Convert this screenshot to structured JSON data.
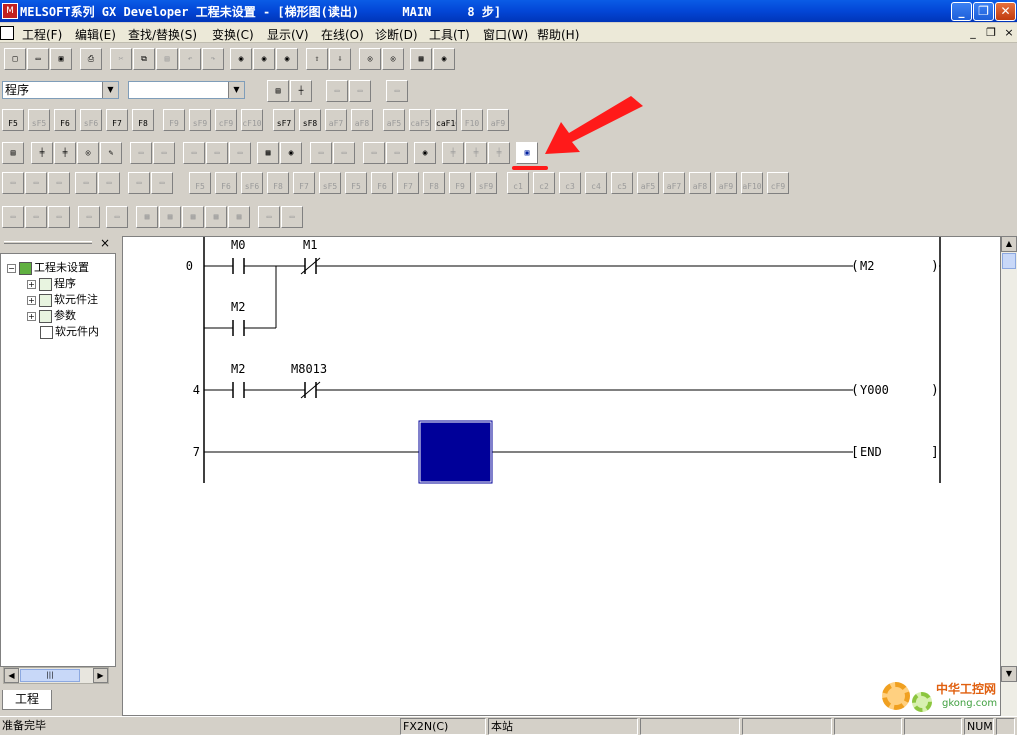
{
  "window": {
    "title": "MELSOFT系列 GX Developer 工程未设置 - [梯形图(读出)      MAIN     8 步]",
    "icon_label": "M",
    "minimize": "_",
    "restore": "❐",
    "close": "✕"
  },
  "menu": {
    "items": [
      "工程(F)",
      "编辑(E)",
      "查找/替换(S)",
      "变换(C)",
      "显示(V)",
      "在线(O)",
      "诊断(D)",
      "工具(T)",
      "窗口(W)",
      "帮助(H)"
    ],
    "mdi_minimize": "_",
    "mdi_restore": "❐",
    "mdi_close": "×"
  },
  "toolbar": {
    "data_type_select": "程序",
    "program_select": "",
    "ladder_keys": [
      "F5",
      "sF5",
      "F6",
      "sF6",
      "F7",
      "F8",
      "F9",
      "sF9",
      "cF9",
      "cF10",
      "sF7",
      "sF8",
      "aF7",
      "aF8",
      "aF5",
      "caF5",
      "caF10",
      "F10",
      "aF9"
    ],
    "ladder_key_symbols": [
      "┤├",
      "┤├",
      "┤/├",
      "┤/├",
      "-○-",
      "[ ]",
      "—",
      "—",
      "—",
      "×",
      "┤↑├",
      "┤↓├",
      "┤↑├",
      "┤↓├",
      "↑",
      "↓",
      "-/-",
      "—",
      "—"
    ],
    "device_keys": [
      "F5",
      "F6",
      "sF6",
      "F8",
      "F7",
      "sF5",
      "F5",
      "F6",
      "F7",
      "F8",
      "F9",
      "sF9",
      "c1",
      "c2",
      "c3",
      "c4",
      "c5",
      "aF5",
      "aF7",
      "aF8",
      "aF9",
      "aF10",
      "cF9"
    ]
  },
  "tree": {
    "close": "×",
    "root": "工程未设置",
    "children": [
      "程序",
      "软元件注",
      "参数",
      "软元件内"
    ],
    "tab": "工程",
    "scroll_grip": "|||"
  },
  "ladder": {
    "rungs": [
      {
        "step": "0",
        "contacts": [
          {
            "device": "M0",
            "type": "NO"
          },
          {
            "device": "M1",
            "type": "NC"
          }
        ],
        "branch": {
          "device": "M2",
          "type": "NO"
        },
        "coil": "M2"
      },
      {
        "step": "4",
        "contacts": [
          {
            "device": "M2",
            "type": "NO"
          },
          {
            "device": "M8013",
            "type": "NC"
          }
        ],
        "coil": "Y000"
      },
      {
        "step": "7",
        "contacts": [],
        "coil": "END"
      }
    ],
    "cursor_color": "#000099",
    "annotation_color": "#ff1a1a"
  },
  "status": {
    "message": "准备完毕",
    "plc": "FX2N(C)",
    "station": "本站",
    "num": "NUM"
  },
  "watermark": {
    "line1": "中华工控网",
    "line2": "gkong.com"
  }
}
